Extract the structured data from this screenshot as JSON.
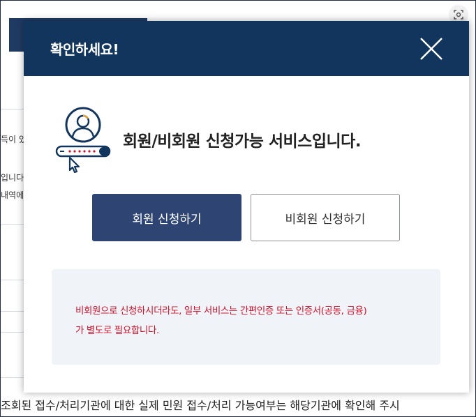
{
  "modal": {
    "title": "확인하세요!",
    "notice": "회원/비회원 신청가능 서비스입니다.",
    "member_button": "회원 신청하기",
    "guest_button": "비회원 신청하기",
    "info_line1": "비회원으로 신청하시더라도, 일부 서비스는 간편인증 또는 인증서(공동, 금융)",
    "info_line2": "가 별도로 필요합니다."
  },
  "background": {
    "side_text1": "득이 있",
    "side_text2": "입니다",
    "side_text3": "내역에",
    "bottom_text": "조회된 접수/처리기관에 대한 실제 민원 접수/처리 가능여부는 해당기관에 확인해 주시"
  },
  "colors": {
    "header_bg": "#12355e",
    "member_button_bg": "#2e4574",
    "info_text": "#d1122a",
    "info_bg": "#f0f4f9"
  },
  "icons": {
    "close": "close-icon",
    "user_login": "user-login-icon",
    "lens": "lens-icon"
  }
}
